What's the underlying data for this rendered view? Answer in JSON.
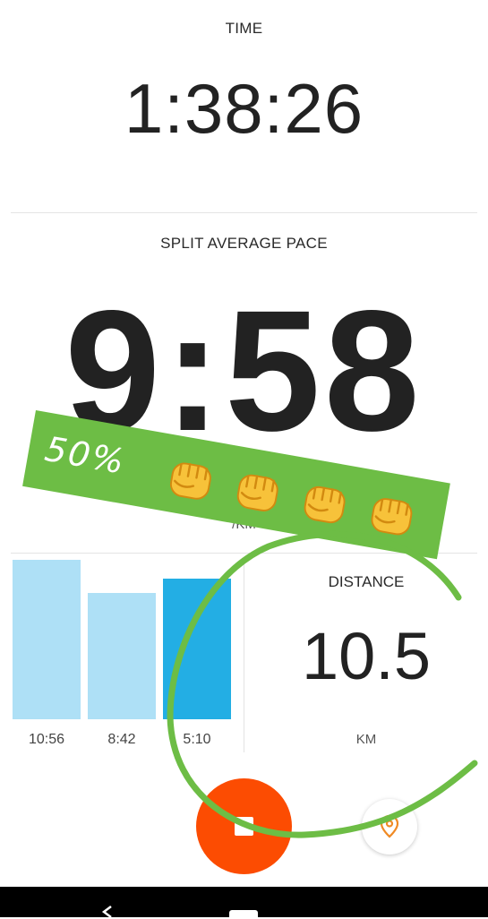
{
  "time": {
    "label": "TIME",
    "value": "1:38:26"
  },
  "pace": {
    "label": "SPLIT AVERAGE PACE",
    "value": "9:58",
    "unit": "/KM"
  },
  "splits": {
    "chart_data": {
      "type": "bar",
      "categories": [
        "10:56",
        "8:42",
        "5:10"
      ],
      "values": [
        1.0,
        0.79,
        0.88
      ],
      "highlighted_index": 2
    },
    "colors": {
      "bar": "#aee0f6",
      "bar_highlight": "#23aee4"
    }
  },
  "distance": {
    "label": "DISTANCE",
    "value": "10.5",
    "unit": "KM"
  },
  "controls": {
    "stop_button_color": "#fc4c02",
    "stop_icon": "stop-icon",
    "location_icon": "map-pin-icon"
  },
  "annotation": {
    "text": "50%",
    "emoji_icons": [
      "fist-icon",
      "fist-icon",
      "fist-icon",
      "fist-icon"
    ],
    "color": "#6dbd45"
  }
}
